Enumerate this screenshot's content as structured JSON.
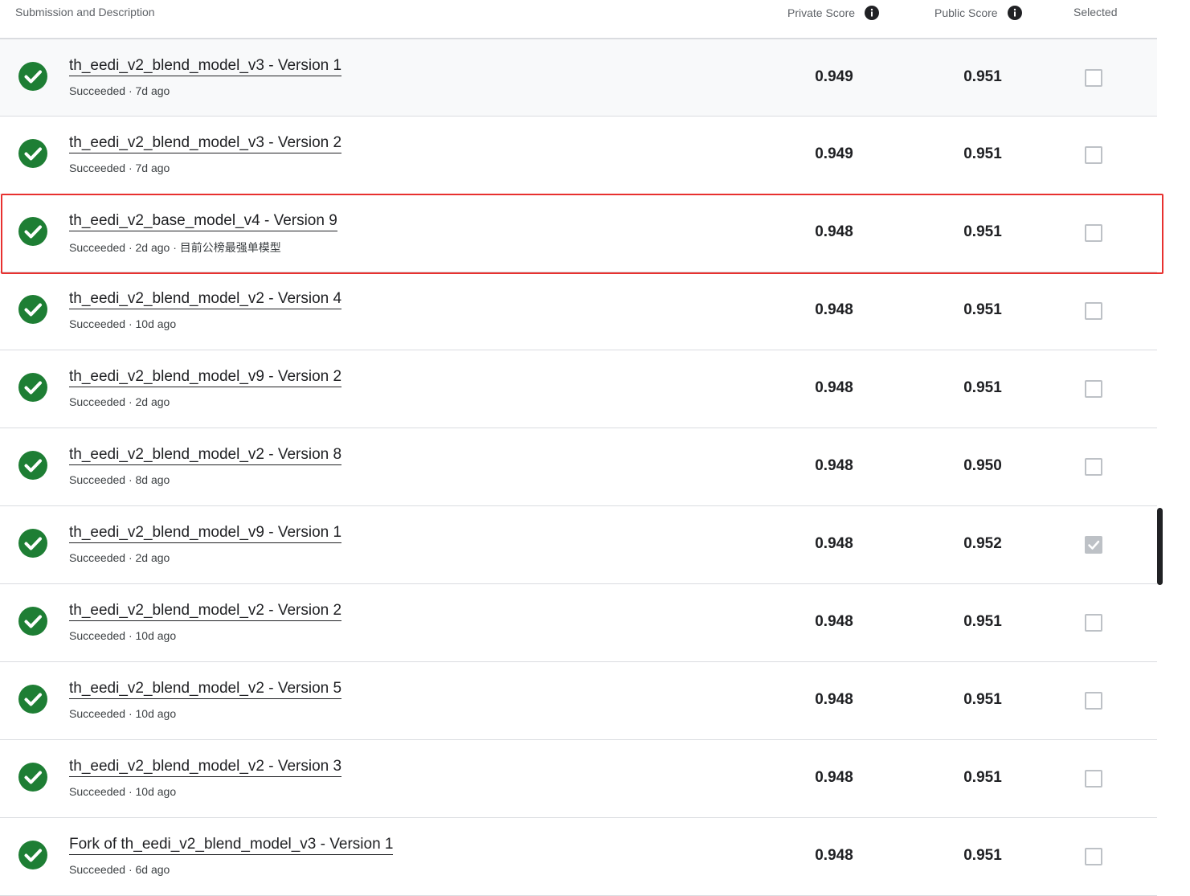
{
  "header": {
    "submission_label": "Submission and Description",
    "private_label": "Private Score",
    "public_label": "Public Score",
    "selected_label": "Selected"
  },
  "icons": {
    "status": "check-circle-icon",
    "info": "info-icon",
    "success_color": "#1e7e34",
    "highlight_color": "#e8312f"
  },
  "rows": [
    {
      "title": "th_eedi_v2_blend_model_v3 - Version 1",
      "meta": "Succeeded · 7d ago",
      "private": "0.949",
      "public": "0.951",
      "selected": false
    },
    {
      "title": "th_eedi_v2_blend_model_v3 - Version 2",
      "meta": "Succeeded · 7d ago",
      "private": "0.949",
      "public": "0.951",
      "selected": false
    },
    {
      "title": "th_eedi_v2_base_model_v4 - Version 9",
      "meta": "Succeeded · 2d ago · 目前公榜最强单模型",
      "private": "0.948",
      "public": "0.951",
      "selected": false
    },
    {
      "title": "th_eedi_v2_blend_model_v2 - Version 4",
      "meta": "Succeeded · 10d ago",
      "private": "0.948",
      "public": "0.951",
      "selected": false
    },
    {
      "title": "th_eedi_v2_blend_model_v9 - Version 2",
      "meta": "Succeeded · 2d ago",
      "private": "0.948",
      "public": "0.951",
      "selected": false
    },
    {
      "title": "th_eedi_v2_blend_model_v2 - Version 8",
      "meta": "Succeeded · 8d ago",
      "private": "0.948",
      "public": "0.950",
      "selected": false
    },
    {
      "title": "th_eedi_v2_blend_model_v9 - Version 1",
      "meta": "Succeeded · 2d ago",
      "private": "0.948",
      "public": "0.952",
      "selected": true
    },
    {
      "title": "th_eedi_v2_blend_model_v2 - Version 2",
      "meta": "Succeeded · 10d ago",
      "private": "0.948",
      "public": "0.951",
      "selected": false
    },
    {
      "title": "th_eedi_v2_blend_model_v2 - Version 5",
      "meta": "Succeeded · 10d ago",
      "private": "0.948",
      "public": "0.951",
      "selected": false
    },
    {
      "title": "th_eedi_v2_blend_model_v2 - Version 3",
      "meta": "Succeeded · 10d ago",
      "private": "0.948",
      "public": "0.951",
      "selected": false
    },
    {
      "title": "Fork of th_eedi_v2_blend_model_v3 - Version 1",
      "meta": "Succeeded · 6d ago",
      "private": "0.948",
      "public": "0.951",
      "selected": false
    }
  ]
}
